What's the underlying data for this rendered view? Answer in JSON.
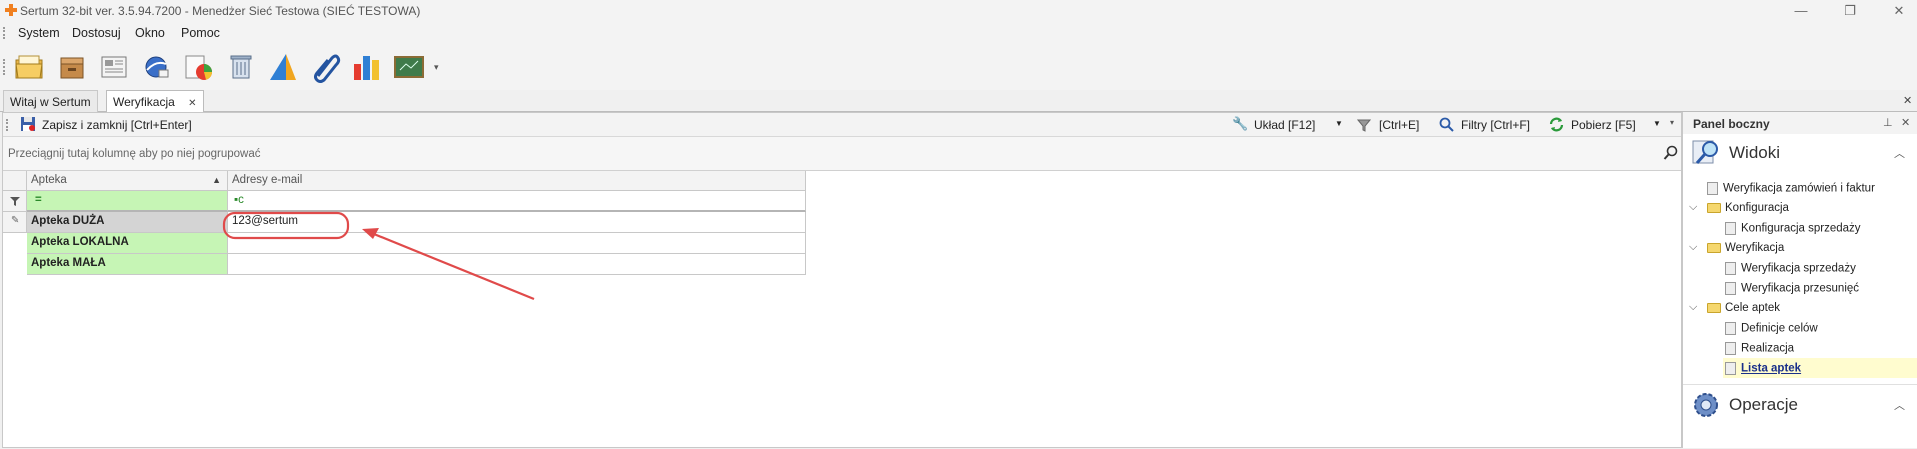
{
  "window": {
    "title": "Sertum 32-bit ver. 3.5.94.7200 - Menedżer Sieć Testowa (SIEĆ TESTOWA)",
    "minimize": "—",
    "restore": "❐",
    "close": "✕"
  },
  "menu": [
    "System",
    "Dostosuj",
    "Okno",
    "Pomoc"
  ],
  "toolbar_icons": [
    "folder-icon",
    "box-icon",
    "document-icon",
    "globe-icon",
    "chart-pie-icon",
    "bin-icon",
    "triangle-chart-icon",
    "paperclip-icon",
    "bar-chart-icon",
    "board-icon"
  ],
  "tabs": [
    {
      "label": "Witaj w Sertum"
    },
    {
      "label": "Weryfikacja",
      "close": "✕"
    }
  ],
  "tabs_close_all": "✕",
  "doc_toolbar": {
    "save_close": "Zapisz i zamknij [Ctrl+Enter]",
    "layout": "Układ [F12]",
    "ctrl_e": "[Ctrl+E]",
    "filters": "Filtry [Ctrl+F]",
    "fetch": "Pobierz [F5]"
  },
  "group_hint": "Przeciągnij tutaj kolumnę aby po niej pogrupować",
  "grid": {
    "col_pharmacy": "Apteka",
    "col_email": "Adresy e-mail",
    "filter_pharmacy": "=",
    "filter_email": "▪c",
    "rows": [
      {
        "name": "Apteka DUŻA",
        "email": "123@sertum"
      },
      {
        "name": "Apteka LOKALNA",
        "email": ""
      },
      {
        "name": "Apteka MAŁA",
        "email": ""
      }
    ]
  },
  "panel": {
    "title": "Panel boczny",
    "views_title": "Widoki",
    "operations_title": "Operacje",
    "tree": [
      {
        "label": "Weryfikacja zamówień i faktur",
        "type": "doc",
        "level": 0
      },
      {
        "label": "Konfiguracja",
        "type": "folder",
        "level": 0
      },
      {
        "label": "Konfiguracja sprzedaży",
        "type": "doc",
        "level": 1
      },
      {
        "label": "Weryfikacja",
        "type": "folder",
        "level": 0
      },
      {
        "label": "Weryfikacja sprzedaży",
        "type": "doc",
        "level": 1
      },
      {
        "label": "Weryfikacja przesunięć",
        "type": "doc",
        "level": 1
      },
      {
        "label": "Cele aptek",
        "type": "folder",
        "level": 0
      },
      {
        "label": "Definicje celów",
        "type": "doc",
        "level": 1
      },
      {
        "label": "Realizacja",
        "type": "doc",
        "level": 1
      },
      {
        "label": "Lista aptek",
        "type": "doc",
        "level": 1,
        "selected": true
      }
    ]
  },
  "colors": {
    "accent_green": "#c6f5b5",
    "annotation_red": "#e04a4a",
    "selected_item_bg": "#fffccf"
  }
}
